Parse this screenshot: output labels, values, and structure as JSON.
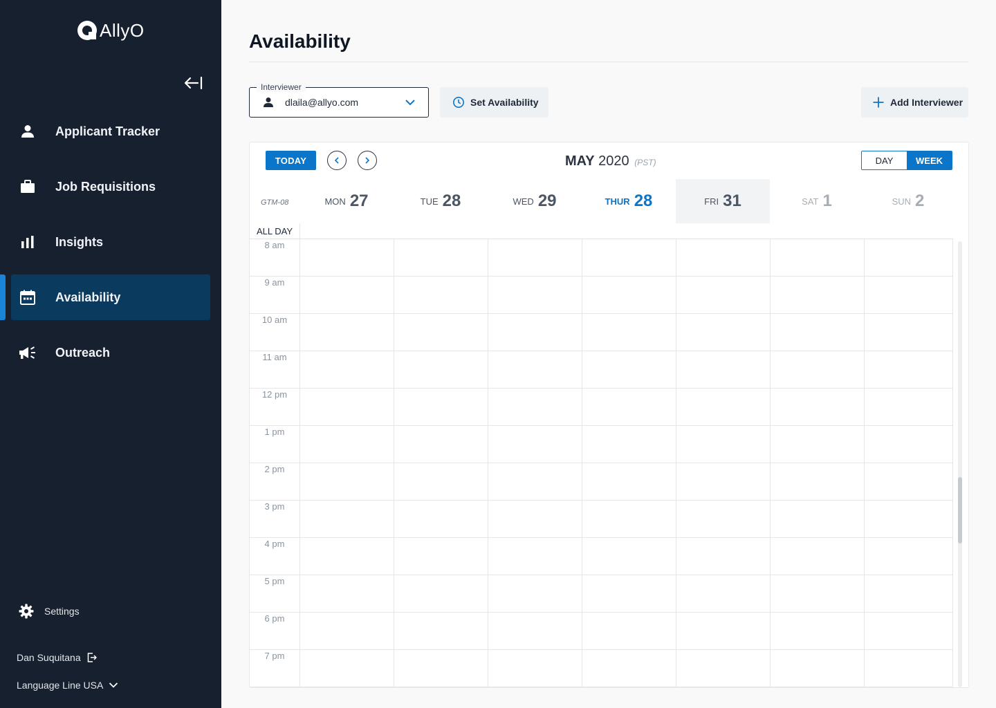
{
  "brand": {
    "name": "AllyO"
  },
  "sidebar": {
    "items": [
      {
        "label": "Applicant Tracker",
        "icon": "person-icon"
      },
      {
        "label": "Job Requisitions",
        "icon": "briefcase-icon"
      },
      {
        "label": "Insights",
        "icon": "bar-chart-icon"
      },
      {
        "label": "Availability",
        "icon": "calendar-icon",
        "active": true
      },
      {
        "label": "Outreach",
        "icon": "megaphone-icon"
      }
    ],
    "settings_label": "Settings",
    "user_name": "Dan Suquitana",
    "org_name": "Language Line USA"
  },
  "page": {
    "title": "Availability",
    "interviewer_legend": "Interviewer",
    "interviewer_value": "dlaila@allyo.com",
    "set_availability_label": "Set Availability",
    "add_interviewer_label": "Add Interviewer"
  },
  "calendar": {
    "today_label": "TODAY",
    "month": "MAY",
    "year": "2020",
    "timezone": "(PST)",
    "view_day": "DAY",
    "view_week": "WEEK",
    "gmt_label": "GTM-08",
    "all_day_label": "ALL DAY",
    "days": [
      {
        "name": "MON",
        "date": "27"
      },
      {
        "name": "TUE",
        "date": "28"
      },
      {
        "name": "WED",
        "date": "29"
      },
      {
        "name": "THUR",
        "date": "28"
      },
      {
        "name": "FRI",
        "date": "31"
      },
      {
        "name": "SAT",
        "date": "1"
      },
      {
        "name": "SUN",
        "date": "2"
      }
    ],
    "hours": [
      "8  am",
      "9 am",
      "10 am",
      "11 am",
      "12 pm",
      "1 pm",
      "2 pm",
      "3 pm",
      "4 pm",
      "5 pm",
      "6 pm",
      "7 pm"
    ]
  },
  "colors": {
    "sidebar_bg": "#16202e",
    "active_nav_bg": "#0b3a5f",
    "accent": "#0b76c9"
  }
}
